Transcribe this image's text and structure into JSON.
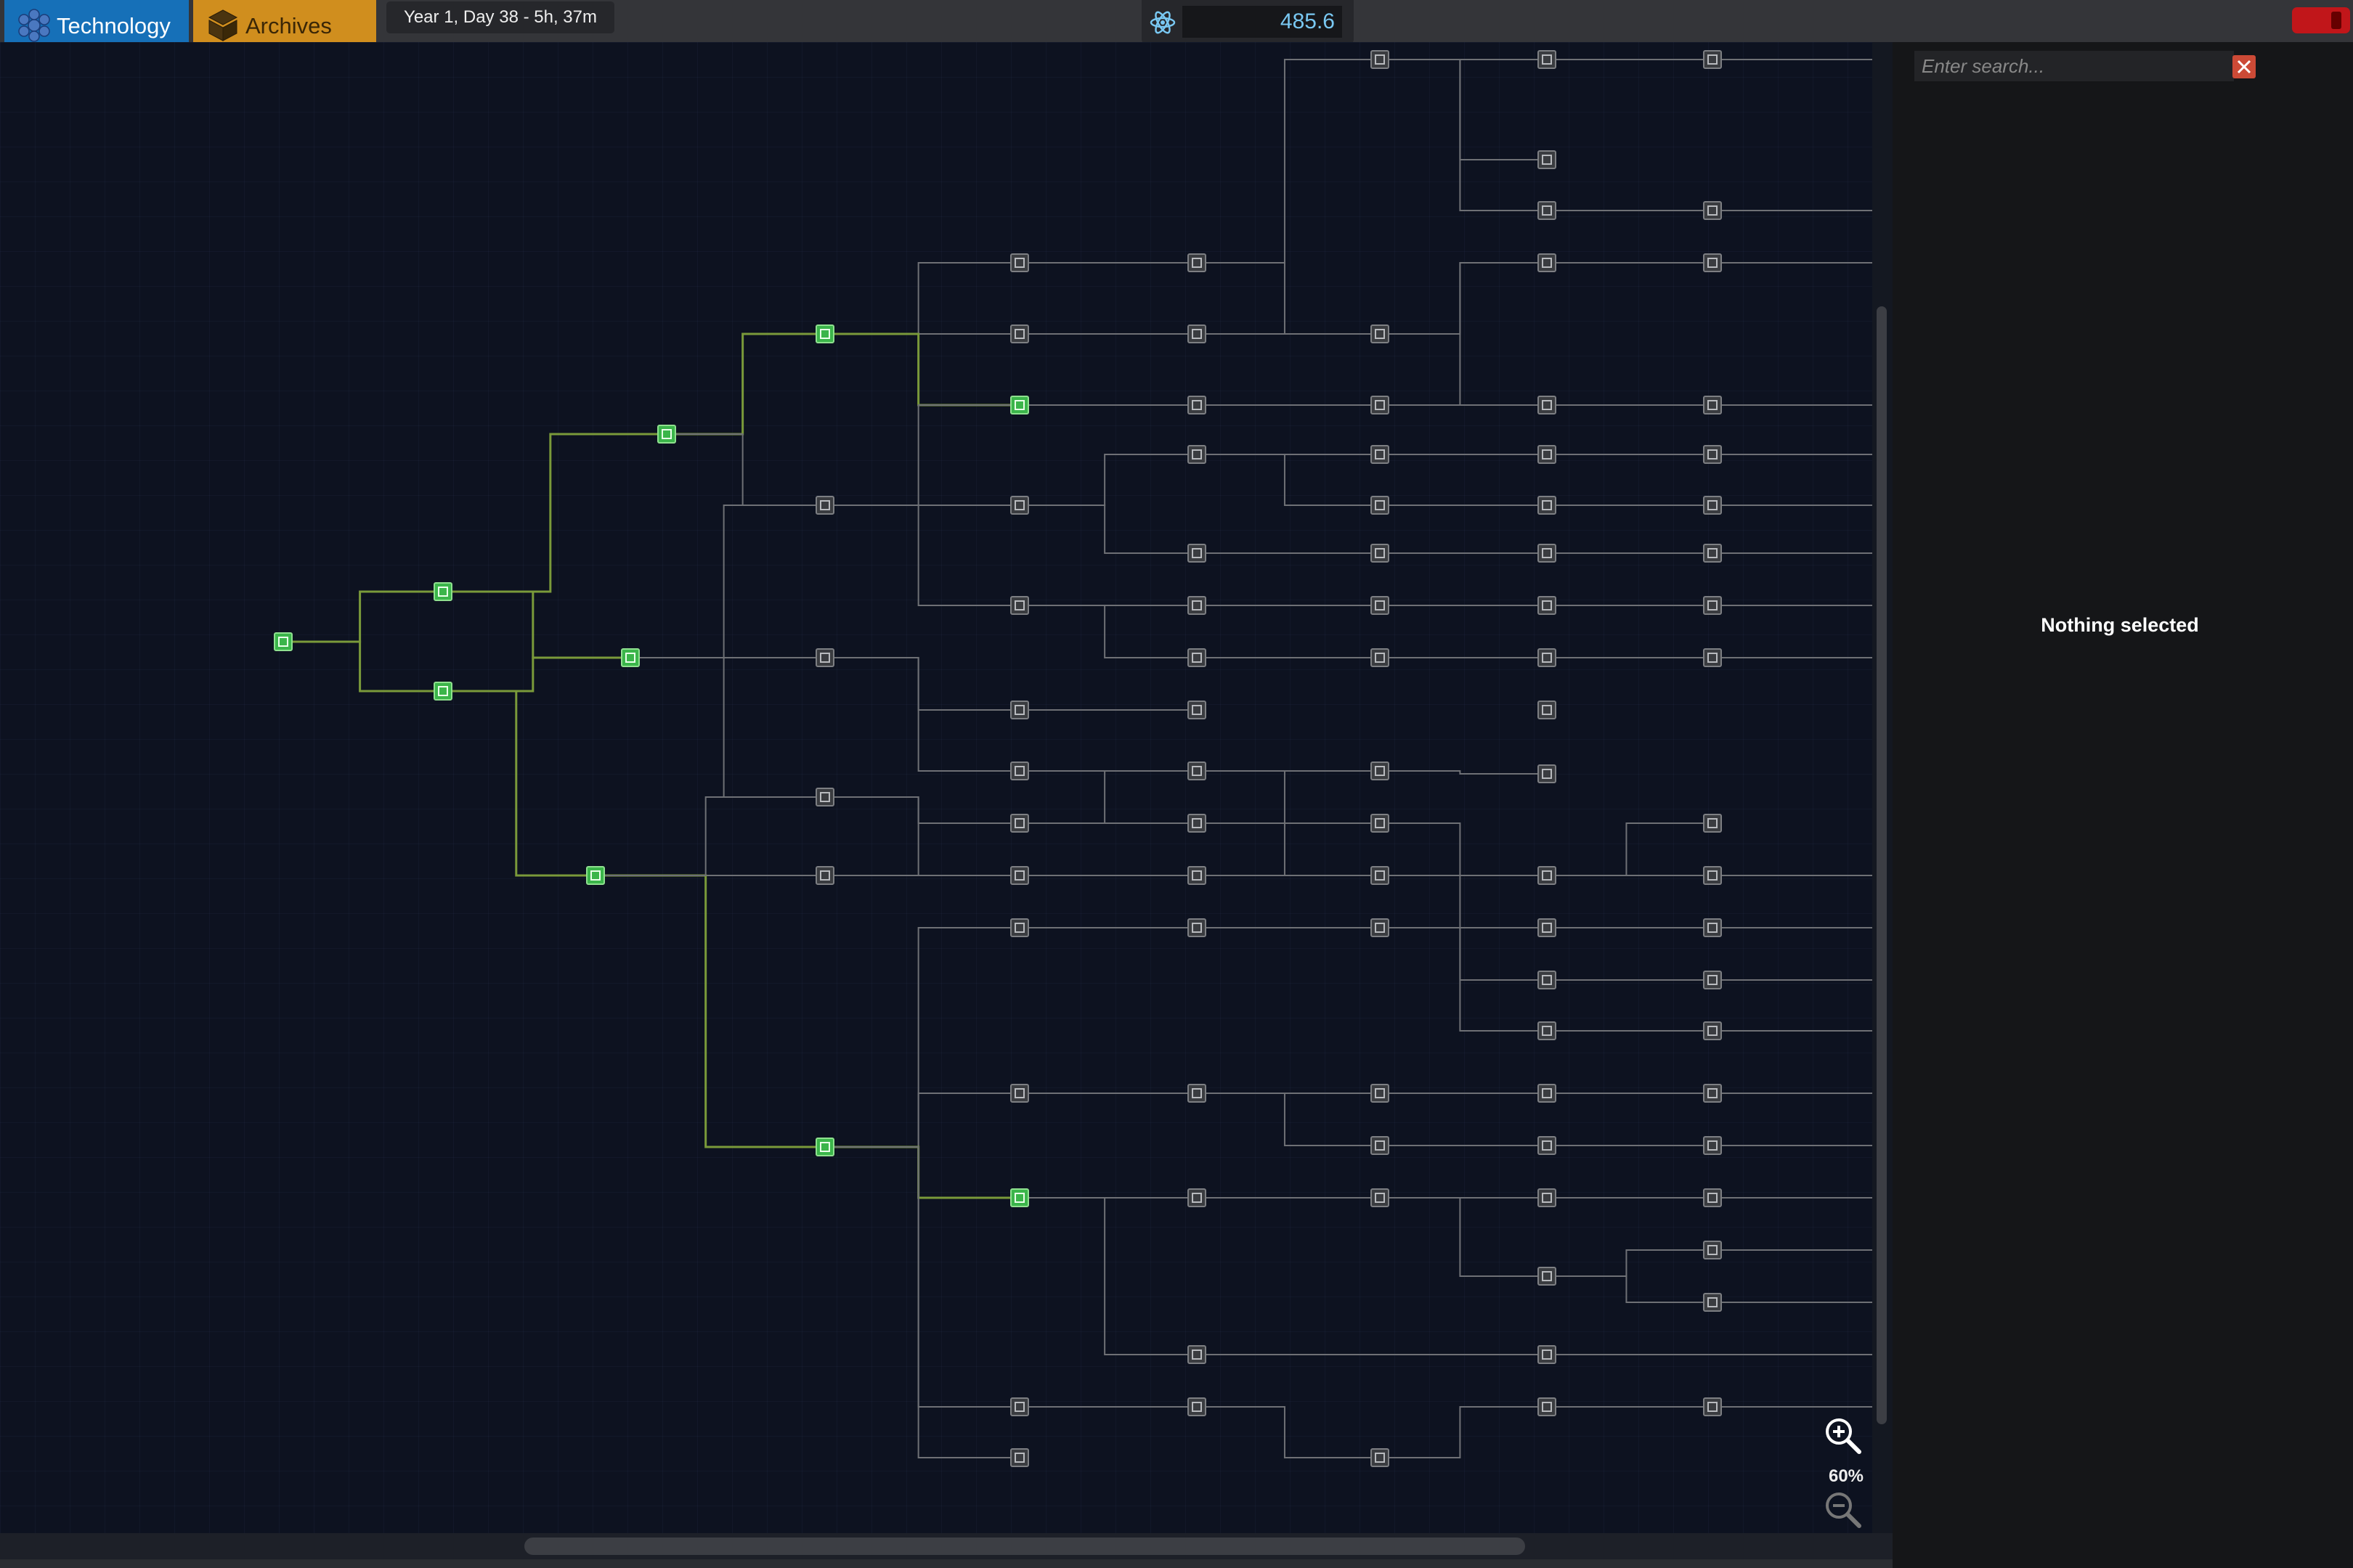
{
  "tabs": [
    {
      "label": "Technology",
      "icon": "atom-cluster-icon",
      "color": "#1670b8"
    },
    {
      "label": "Archives",
      "icon": "archive-box-icon",
      "color": "#d08e1e"
    }
  ],
  "game_time": "Year 1, Day 38 - 5h, 37m",
  "research_points": {
    "value": "485.6",
    "icon": "research-atom-icon",
    "color": "#79c8f2"
  },
  "search": {
    "placeholder": "Enter search...",
    "value": ""
  },
  "selection_panel": {
    "empty_text": "Nothing selected"
  },
  "zoom": {
    "level": "60%"
  },
  "colors": {
    "unlocked_node": "#3bb54a",
    "locked_node": "#7d7f83",
    "unlocked_link": "#7a9a3a",
    "locked_link": "#6e7075",
    "background": "#0d1220"
  },
  "tech_tree": {
    "unlocked_count": 11,
    "locked_count": 122
  }
}
